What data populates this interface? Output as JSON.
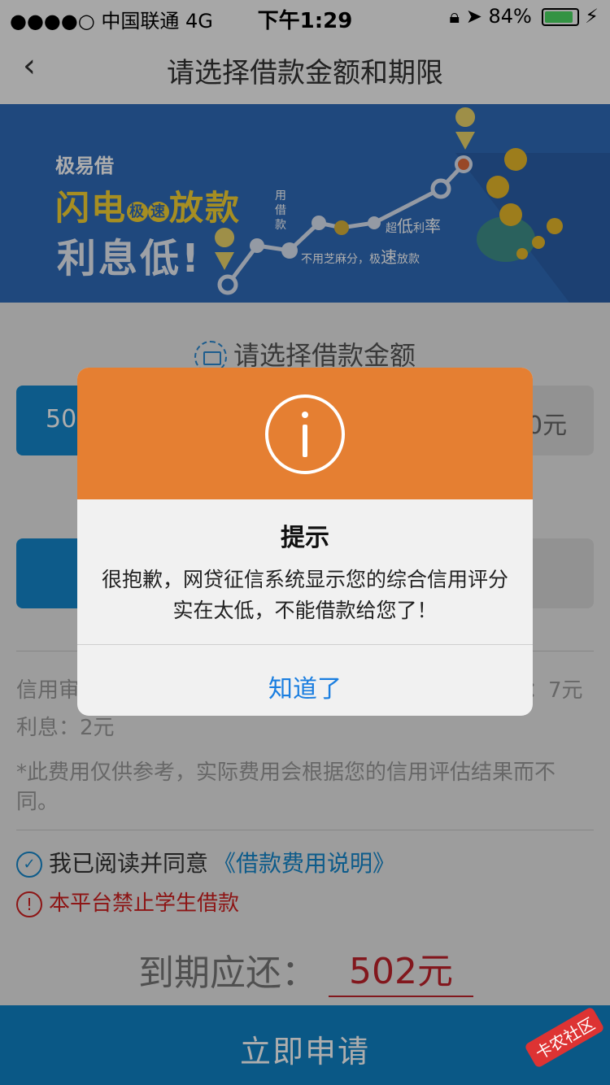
{
  "status_bar": {
    "carrier": "●●●●○ 中国联通  4G",
    "time": "下午1:29",
    "battery": "84%"
  },
  "nav": {
    "title": "请选择借款金额和期限"
  },
  "banner": {
    "brand": "极易借",
    "line1_a": "闪电",
    "line1_badge_a": "极",
    "line1_badge_b": "速",
    "line1_b": "放款",
    "line2": "利息低!",
    "label_use": "用借款",
    "label_fast_a": "不用芝麻分，极",
    "label_fast_b": "速",
    "label_fast_c": "放款",
    "label_rate_a": "超",
    "label_rate_b": "低",
    "label_rate_c": "利",
    "label_rate_d": "率"
  },
  "body": {
    "amount_title": "请选择借款金额",
    "amount_left": "50",
    "amount_right": "0元",
    "fee_left": "信用审",
    "fee_right": "：7元",
    "interest": "利息：2元",
    "note": "*此费用仅供参考，实际费用会根据您的信用评估结果而不同。",
    "agree_text": "我已阅读并同意",
    "agree_link": "《借款费用说明》",
    "student_warn": "本平台禁止学生借款",
    "due_label": "到期应还：",
    "due_value": "502元",
    "apply_button": "立即申请"
  },
  "dialog": {
    "title": "提示",
    "message": "很抱歉，网贷征信系统显示您的综合信用评分实在太低，不能借款给您了！",
    "button": "知道了"
  },
  "watermark": "卡农社区",
  "colors": {
    "accent_blue": "#1487cc",
    "dialog_orange": "#e57f32",
    "warning_red": "#d01f1f",
    "due_red": "#c0232b"
  }
}
